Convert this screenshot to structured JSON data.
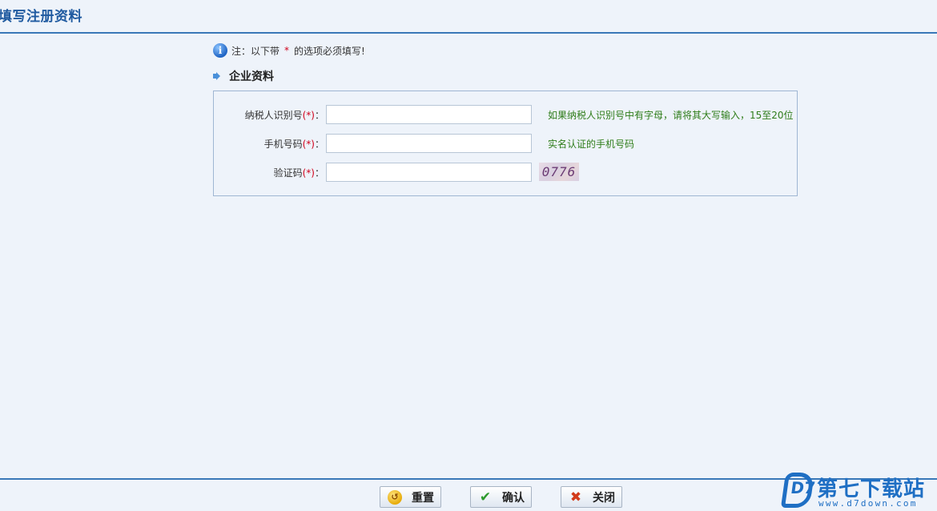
{
  "page": {
    "title": "填写注册资料"
  },
  "note": {
    "text_before": "注：以下带",
    "star": "*",
    "text_after": "的选项必须填写!"
  },
  "section": {
    "label": "企业资料"
  },
  "form": {
    "fields": [
      {
        "label": "纳税人识别号",
        "required": "(*)",
        "colon": "：",
        "value": "",
        "hint": "如果纳税人识别号中有字母，请将其大写输入，15至20位"
      },
      {
        "label": "手机号码",
        "required": "(*)",
        "colon": "：",
        "value": "",
        "hint": "实名认证的手机号码"
      },
      {
        "label": "验证码",
        "required": "(*)",
        "colon": "：",
        "value": "",
        "captcha": "0776"
      }
    ]
  },
  "buttons": {
    "reset": "重置",
    "confirm": "确认",
    "close": "关闭"
  },
  "watermark": {
    "name": "第七下载站",
    "url": "www.d7down.com",
    "logo": "D7"
  },
  "colors": {
    "accent": "#3a78b8",
    "title": "#1f5aa0",
    "hint": "#2f7d1a",
    "required": "#d0021b",
    "background": "#eef3fa"
  },
  "icons": {
    "info": "info-icon",
    "section": "arrow-right-icon",
    "reset": "reset-icon",
    "confirm": "checkmark-icon",
    "close": "close-icon"
  }
}
